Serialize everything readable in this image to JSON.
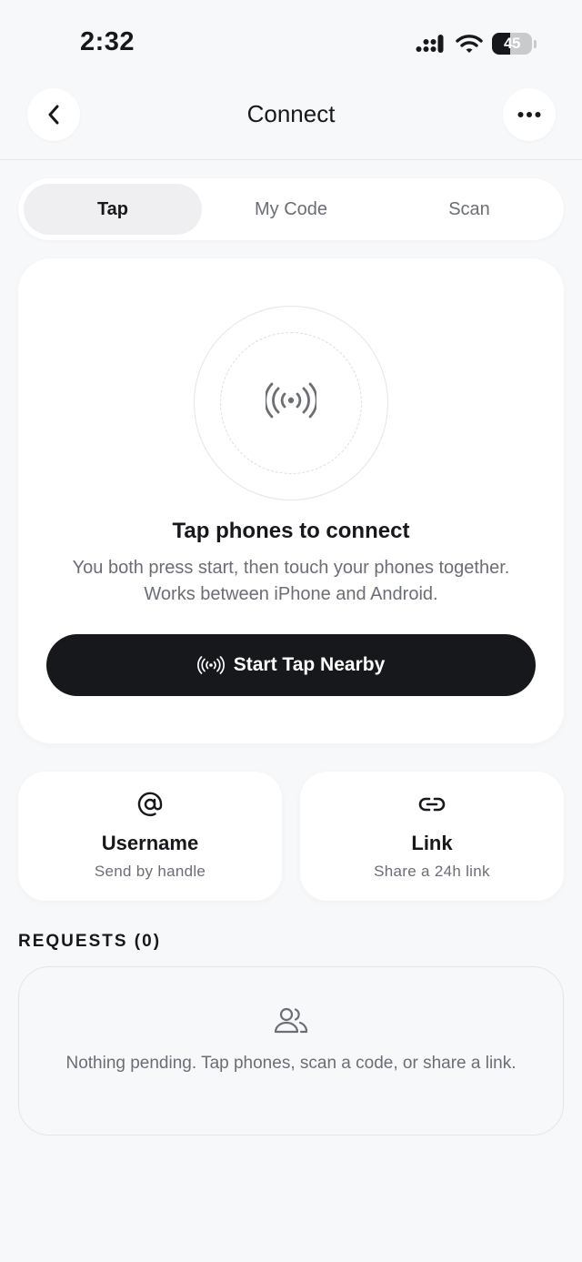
{
  "status_bar": {
    "time": "2:32",
    "battery": "45",
    "battery_level": 0.45
  },
  "header": {
    "title": "Connect"
  },
  "tabs": [
    {
      "label": "Tap",
      "active": true
    },
    {
      "label": "My Code",
      "active": false
    },
    {
      "label": "Scan",
      "active": false
    }
  ],
  "tap_card": {
    "title": "Tap phones to connect",
    "description": "You both press start, then touch your phones together. Works between iPhone and Android.",
    "button_label": "Start Tap Nearby"
  },
  "options": [
    {
      "title": "Username",
      "subtitle": "Send by handle",
      "icon": "at-icon"
    },
    {
      "title": "Link",
      "subtitle": "Share a 24h link",
      "icon": "link-icon"
    }
  ],
  "requests": {
    "heading": "REQUESTS (0)",
    "empty_text": "Nothing pending. Tap phones, scan a code, or share a link."
  },
  "colors": {
    "text": "#17181b",
    "muted": "#6b6e75",
    "primary_button": "#17181b",
    "background": "#f7f8fa"
  }
}
